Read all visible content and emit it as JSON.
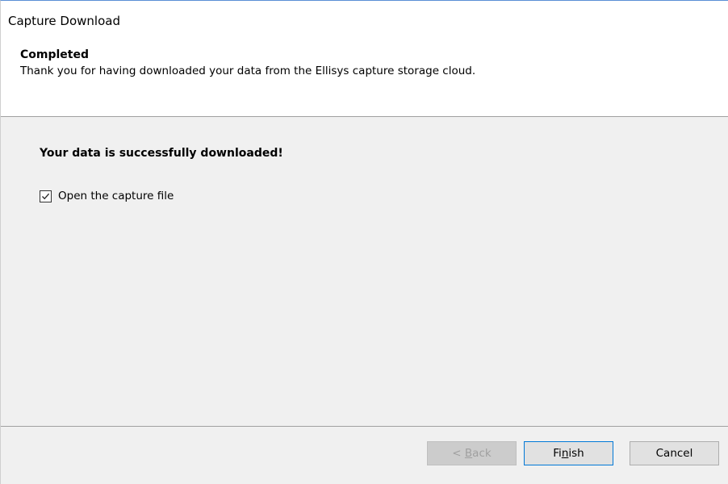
{
  "window": {
    "title": "Capture Download"
  },
  "header": {
    "title": "Completed",
    "subtitle": "Thank you for having downloaded your data from the Ellisys capture storage cloud."
  },
  "body": {
    "success_message": "Your data is successfully downloaded!",
    "open_capture_checkbox": {
      "label": "Open the capture file",
      "checked": true
    }
  },
  "footer": {
    "back_button": {
      "prefix": "< ",
      "mnemonic": "B",
      "rest": "ack",
      "enabled": false
    },
    "finish_button": {
      "prefix": "Fi",
      "mnemonic": "n",
      "rest": "ish",
      "enabled": true
    },
    "cancel_button": {
      "label": "Cancel",
      "enabled": true
    }
  },
  "colors": {
    "window_border_accent": "#5a8fd6",
    "content_background": "#f0f0f0",
    "button_face": "#e1e1e1",
    "default_button_border": "#0078d7",
    "disabled_text": "#a0a0a0"
  },
  "icons": {
    "checkbox_mark": "checkmark-icon"
  }
}
